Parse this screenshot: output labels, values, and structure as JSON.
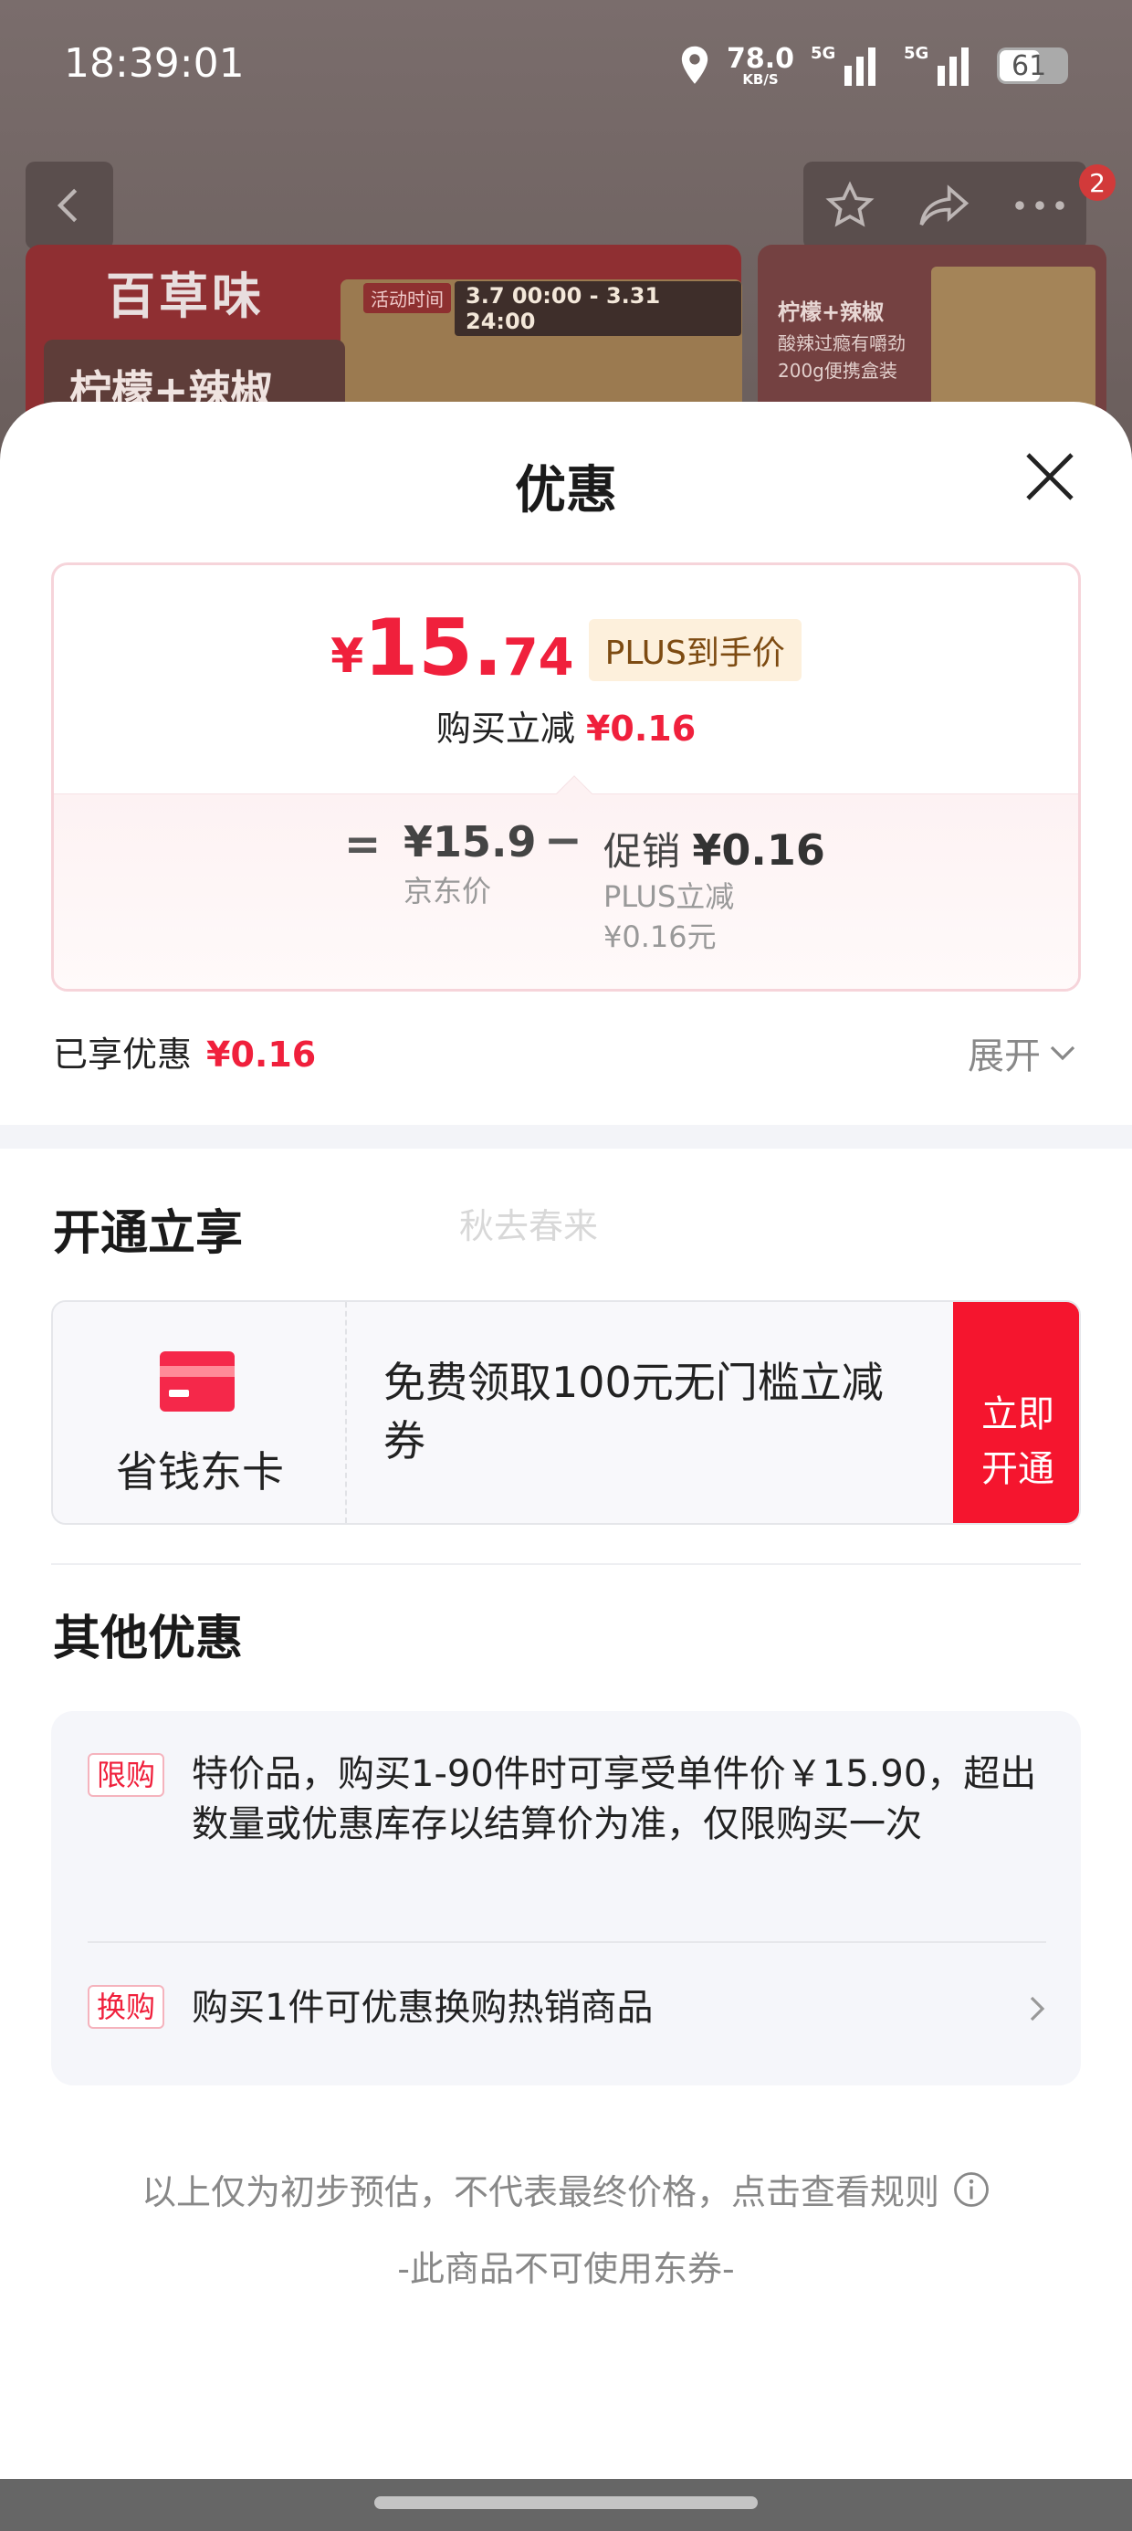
{
  "status_bar": {
    "time": "18:39:01",
    "net_speed": "78.0",
    "net_unit": "KB/S",
    "signal_label_1": "5G",
    "signal_label_2": "5G",
    "battery": "61"
  },
  "background_page": {
    "brand_logo": "百草味",
    "activity_tag": "活动时间",
    "activity_date": "3.7 00:00 - 3.31 24:00",
    "banner_flavor": "柠檬+辣椒",
    "thumb_title": "柠檬+辣椒",
    "thumb_line1": "酸辣过瘾有嚼劲",
    "thumb_line2": "200g便携盒装",
    "cart_badge": "2"
  },
  "sheet": {
    "title": "优惠",
    "price": {
      "currency": "¥",
      "integer": "15.",
      "decimal": "74",
      "plus_label": "PLUS到手价",
      "reduce_label": "购买立减",
      "reduce_value": "¥0.16",
      "equals": "=",
      "jd_price": "¥15.9",
      "jd_price_label": "京东价",
      "minus": "−",
      "promo_label": "促销",
      "promo_value": "¥0.16",
      "plus_reduce_label": "PLUS立减",
      "plus_reduce_value": "¥0.16元"
    },
    "enjoyed_label": "已享优惠",
    "enjoyed_value": "¥0.16",
    "expand_label": "展开",
    "open_section_title": "开通立享",
    "watermark": "秋去春来",
    "card": {
      "name": "省钱东卡",
      "description": "免费领取100元无门槛立减券",
      "button_line1": "立即",
      "button_line2": "开通"
    },
    "other_section_title": "其他优惠",
    "offers": [
      {
        "tag": "限购",
        "text": "特价品，购买1-90件时可享受单件价￥15.90，超出数量或优惠库存以结算价为准，仅限购买一次"
      },
      {
        "tag": "换购",
        "text": "购买1件可优惠换购热销商品"
      }
    ],
    "footer_note": "以上仅为初步预估，不代表最终价格，点击查看规则",
    "footer_note2": "-此商品不可使用东券-"
  },
  "colors": {
    "accent_red": "#f0203c",
    "button_red": "#f5152e",
    "plus_bg": "#fdf0dc",
    "plus_text": "#7d4b12"
  },
  "icons": [
    "location-pin-icon",
    "signal-icon",
    "battery-icon",
    "back-arrow-icon",
    "star-icon",
    "share-icon",
    "more-icon",
    "close-icon",
    "card-icon",
    "chevron-down-icon",
    "chevron-right-icon",
    "info-icon"
  ]
}
